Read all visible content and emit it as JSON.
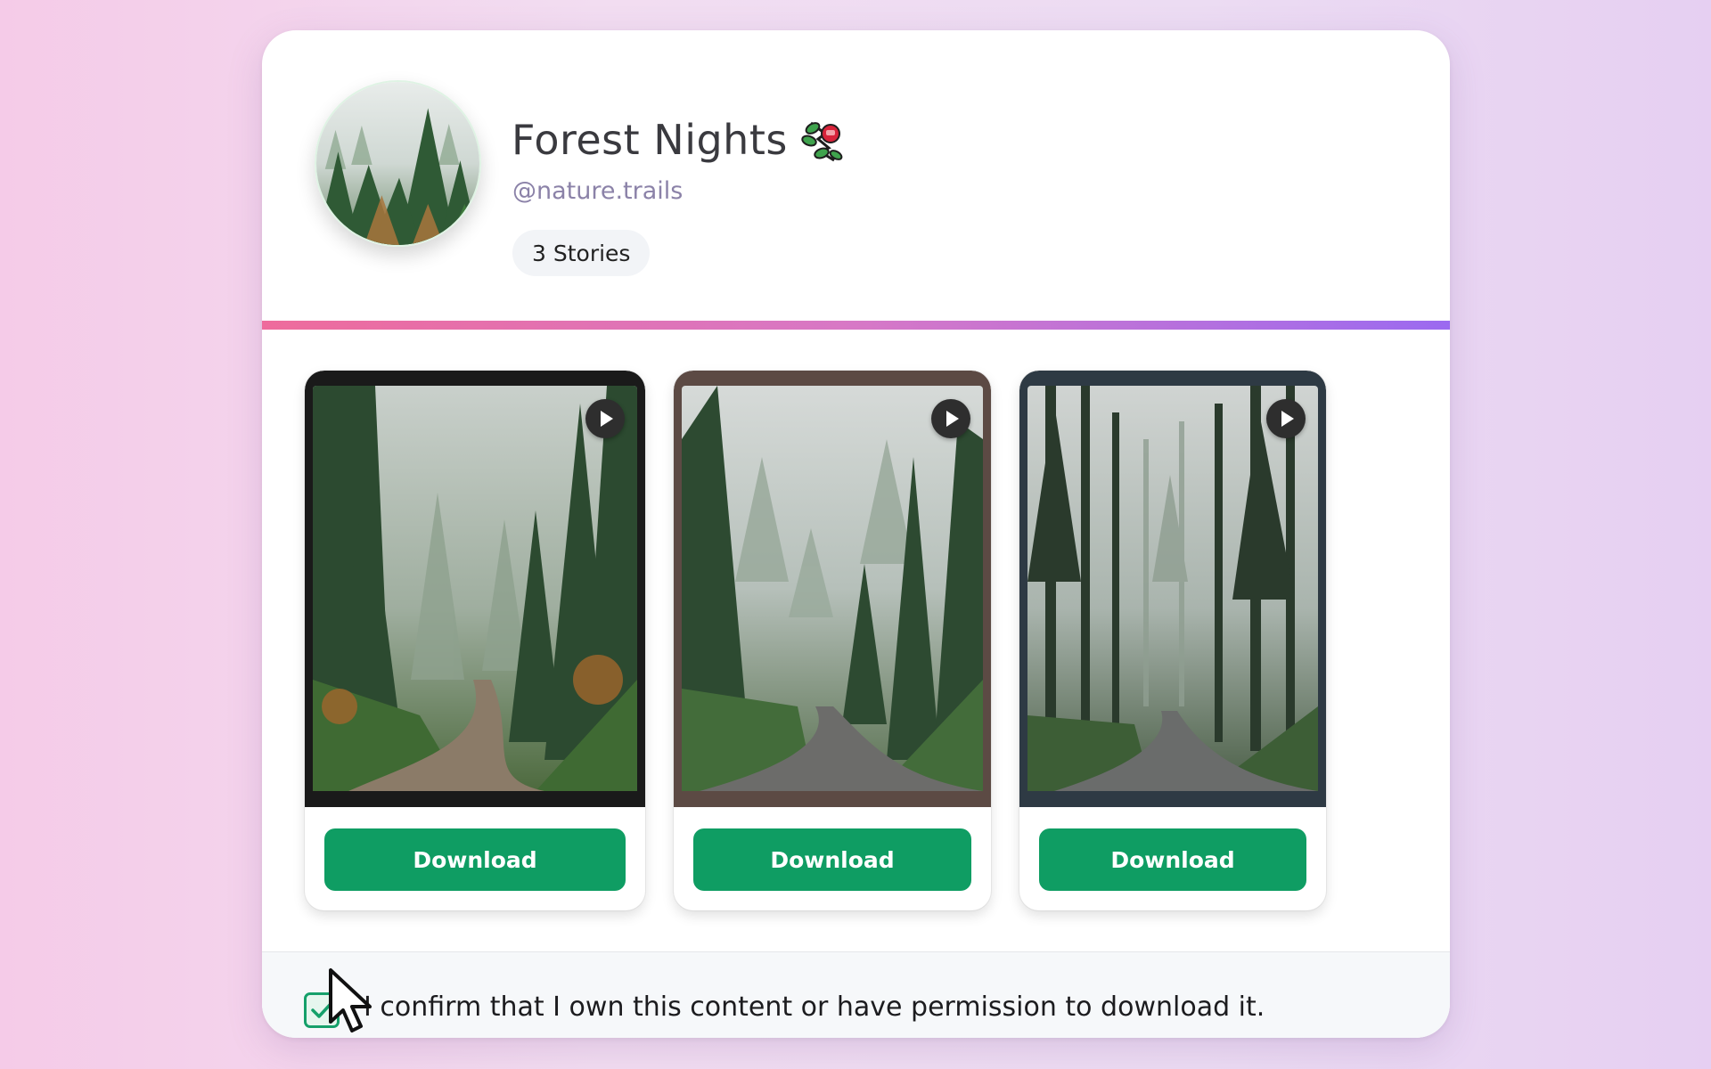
{
  "profile": {
    "name": "Forest Nights",
    "handle": "@nature.trails",
    "stories_badge": "3 Stories",
    "title_icon": "mistletoe-emoji"
  },
  "colors": {
    "accent_gradient": [
      "#ee6b9c",
      "#d778c6",
      "#9b6af0"
    ],
    "download_button": "#0f9d63",
    "checkbox_accent": "#15a06a"
  },
  "stories": [
    {
      "download_label": "Download",
      "media_icon": "play-icon"
    },
    {
      "download_label": "Download",
      "media_icon": "play-icon"
    },
    {
      "download_label": "Download",
      "media_icon": "play-icon"
    }
  ],
  "footer": {
    "confirm_checked": true,
    "confirm_text": "I confirm that I own this content or have permission to download it."
  }
}
